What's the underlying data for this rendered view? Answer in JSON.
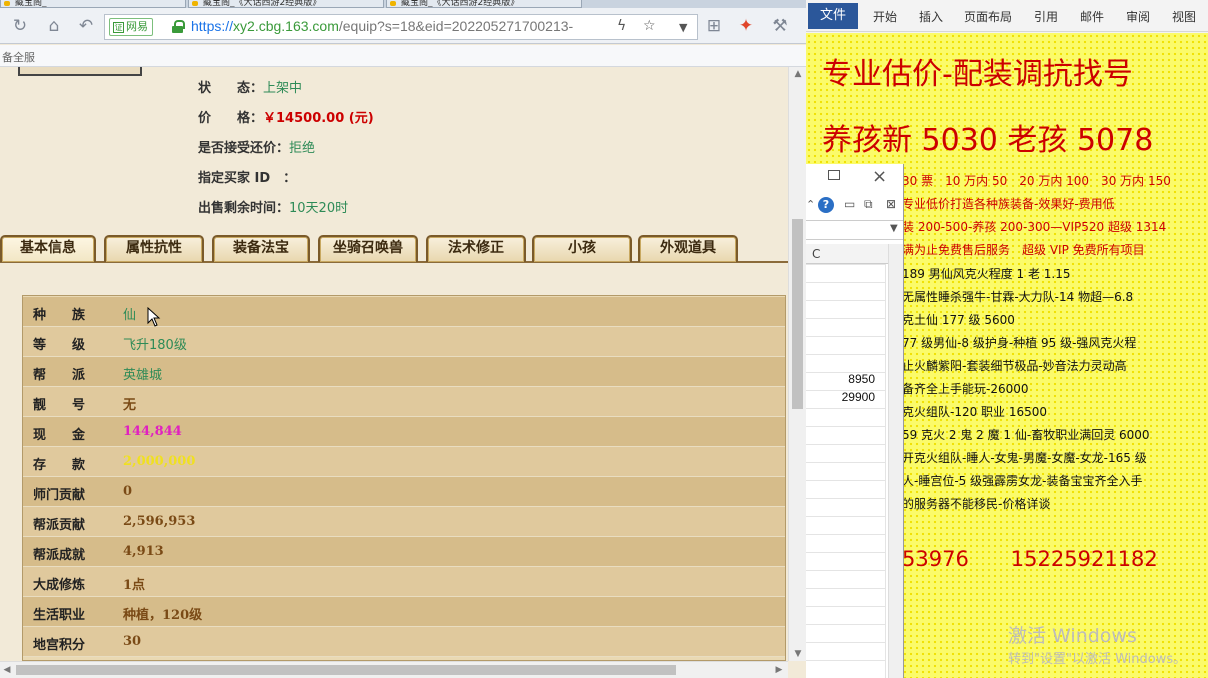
{
  "browser": {
    "tabs": [
      {
        "label": "藏宝阁_"
      },
      {
        "label": "藏宝阁_《大话西游2经典版》"
      },
      {
        "label": "藏宝阁_《大话西游2经典版》"
      }
    ],
    "nav": {
      "refresh_icon": "refresh-icon",
      "home_icon": "home-icon",
      "back_icon": "back-icon"
    },
    "address": {
      "badge": "网易",
      "scheme": "https://",
      "host": "xy2.cbg.163.com",
      "path": "/equip?s=18&eid=202205271700213-"
    },
    "bookmark_bar_text": "备全服",
    "item_info": {
      "status_label": "状　　态：",
      "status_value": "上架中",
      "price_label": "价　　格：",
      "price_value": "￥14500.00 (元)",
      "bargain_label": "是否接受还价：",
      "bargain_value": "拒绝",
      "buyer_label": "指定买家 ID　：",
      "buyer_value": "",
      "time_label": "出售剩余时间：",
      "time_value": "10天20时"
    },
    "game_tabs": [
      "基本信息",
      "属性抗性",
      "装备法宝",
      "坐骑召唤兽",
      "法术修正",
      "小孩",
      "外观道具"
    ],
    "attributes": [
      {
        "label": "种　　族",
        "value": "仙",
        "style": "green"
      },
      {
        "label": "等　　级",
        "value": "飞升180级",
        "style": "green"
      },
      {
        "label": "帮　　派",
        "value": "英雄城",
        "style": "green"
      },
      {
        "label": "靓　　号",
        "value": "无",
        "style": "brown"
      },
      {
        "label": "现　　金",
        "value": "144,844",
        "style": "pink"
      },
      {
        "label": "存　　款",
        "value": "2,000,000",
        "style": "yellow"
      },
      {
        "label": "师门贡献",
        "value": "0",
        "style": "brown"
      },
      {
        "label": "帮派贡献",
        "value": "2,596,953",
        "style": "brown"
      },
      {
        "label": "帮派成就",
        "value": "4,913",
        "style": "brown"
      },
      {
        "label": "大成修炼",
        "value": "1点",
        "style": "brown"
      },
      {
        "label": "生活职业",
        "value": "种植，120级",
        "style": "brown"
      },
      {
        "label": "地宫积分",
        "value": "30",
        "style": "brown"
      }
    ]
  },
  "word": {
    "ribbon_tabs": [
      "文件",
      "开始",
      "插入",
      "页面布局",
      "引用",
      "邮件",
      "审阅",
      "视图"
    ],
    "headline1": "专业估价-配装调抗找号",
    "headline2": "养孩新 5030 老孩 5078",
    "lines": [
      "30 票　10 万内 50　20 万内 100　30 万内 150",
      "专业低价打造各种族装备-效果好-费用低",
      "装 200-500-养孩 200-300—VIP520 超级 1314",
      "满为止免费售后服务　超级 VIP 免费所有项目",
      "189 男仙风克火程度 1 老 1.15",
      "无属性睡杀强牛-甘霖-大力队-14 物超—6.8",
      "克土仙 177 级 5600",
      "77 级男仙-8 级护身-种植 95 级-强风克火程",
      "止火麟紫阳-套装细节极品-妙音法力灵动高",
      "备齐全上手能玩-26000",
      "克火组队-120 职业 16500",
      "59 克火 2 鬼 2 魔 1 仙-畜牧职业满回灵 6000",
      "开克火组队-睡人-女鬼-男魔-女魔-女龙-165 级",
      "人-睡宫位-5 级强霹雳女龙-装备宝宝齐全入手",
      "的服务器不能移民-价格详谈"
    ],
    "contact": "53976　　15225921182",
    "watermark_title": "激活 Windows",
    "watermark_sub": "转到\"设置\"以激活 Windows。"
  },
  "excel": {
    "column_label": "C",
    "values": [
      "8950",
      "29900"
    ]
  },
  "colors": {
    "price_red": "#cc0000",
    "value_green": "#2e8b57",
    "word_blue": "#2b579a",
    "doc_yellow": "#fbfb6a"
  }
}
